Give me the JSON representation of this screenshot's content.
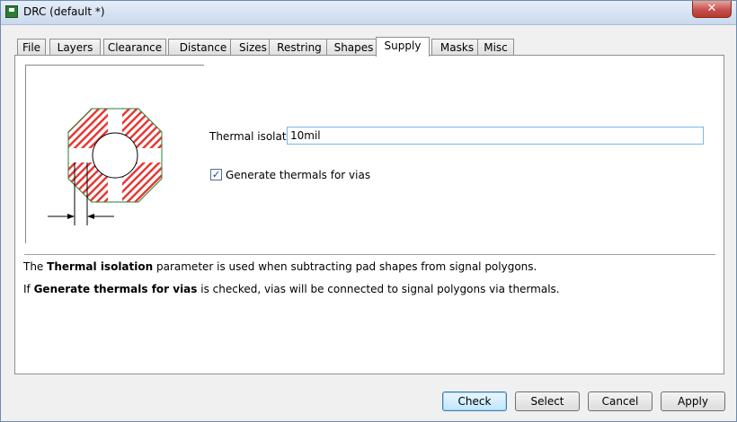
{
  "window": {
    "title": "DRC (default *)",
    "close_label": "✕"
  },
  "tabs": [
    {
      "label": "File"
    },
    {
      "label": "Layers"
    },
    {
      "label": "Clearance"
    },
    {
      "label": "Distance"
    },
    {
      "label": "Sizes"
    },
    {
      "label": "Restring"
    },
    {
      "label": "Shapes"
    },
    {
      "label": "Supply",
      "active": true
    },
    {
      "label": "Masks"
    },
    {
      "label": "Misc"
    }
  ],
  "supply": {
    "thermal_isolation_label": "Thermal isolation",
    "thermal_isolation_value": "10mil",
    "generate_thermals_label": "Generate thermals for vias",
    "generate_thermals_checked": true
  },
  "help": {
    "line1": {
      "pre": "The ",
      "bold": "Thermal isolation",
      "post": " parameter is used when subtracting pad shapes from signal polygons."
    },
    "line2": {
      "pre": "If ",
      "bold": "Generate thermals for vias",
      "post": " is checked, vias will be connected to signal polygons via thermals."
    }
  },
  "buttons": {
    "check": "Check",
    "select": "Select",
    "cancel": "Cancel",
    "apply": "Apply"
  },
  "colors": {
    "thermal_hatch": "#e53935",
    "outline": "#2e7d32",
    "accent": "#3c7fb1"
  }
}
